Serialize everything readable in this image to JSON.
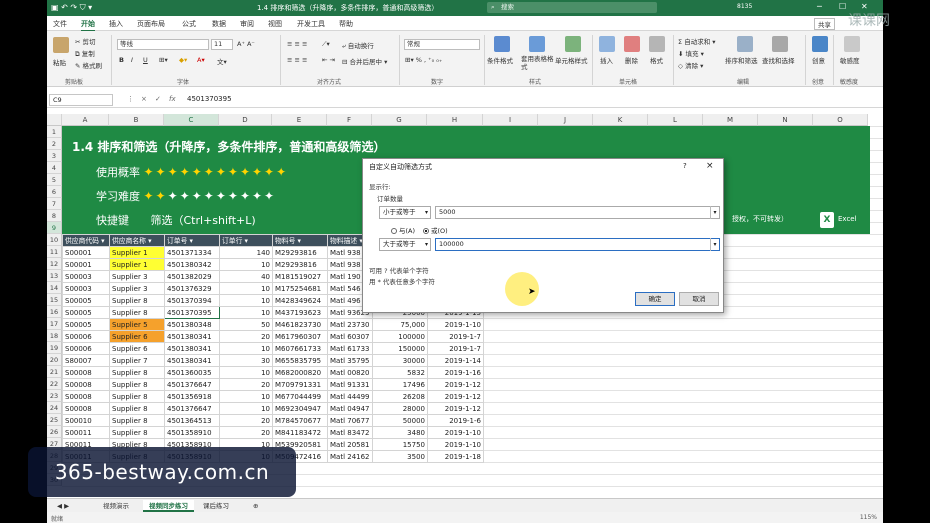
{
  "window": {
    "title": "1.4 排序和筛选（升降序，多条件排序，普通和高级筛选）",
    "search_placeholder": "搜索",
    "user": "8135",
    "logo": "课课网"
  },
  "ribbon": {
    "tabs": [
      "文件",
      "开始",
      "插入",
      "页面布局",
      "公式",
      "数据",
      "审阅",
      "视图",
      "开发工具",
      "帮助"
    ],
    "active_tab": "开始",
    "share_label": "共享",
    "groups": {
      "clipboard": {
        "label": "剪贴板",
        "paste": "粘贴",
        "cut": "剪切",
        "copy": "复制",
        "format_painter": "格式刷"
      },
      "font": {
        "label": "字体",
        "font_name": "等线",
        "font_size": "11",
        "bold": "B",
        "italic": "I",
        "underline": "U"
      },
      "alignment": {
        "label": "对齐方式",
        "wrap": "自动换行",
        "merge": "合并后居中"
      },
      "number": {
        "label": "数字",
        "format": "常规"
      },
      "styles": {
        "label": "样式",
        "conditional": "条件格式",
        "table": "套用表格格式",
        "cell_styles": "单元格样式"
      },
      "cells": {
        "label": "单元格",
        "insert": "插入",
        "delete": "删除",
        "format": "格式"
      },
      "editing": {
        "label": "编辑",
        "autosum": "自动求和",
        "fill": "填充",
        "clear": "清除",
        "sort_filter": "排序和筛选",
        "find_select": "查找和选择"
      },
      "creative": {
        "label": "创意",
        "btn": "创意"
      },
      "sensitivity": {
        "label": "敏感度",
        "btn": "敏感度"
      }
    }
  },
  "formula_bar": {
    "name_box": "C9",
    "cancel": "×",
    "enter": "✓",
    "fx": "fx",
    "value": "4501370395"
  },
  "columns": [
    "A",
    "B",
    "C",
    "D",
    "E",
    "F",
    "G",
    "H",
    "I",
    "J",
    "K",
    "L",
    "M",
    "N",
    "O"
  ],
  "selected_column": "C",
  "rows": [
    "1",
    "2",
    "3",
    "4",
    "5",
    "6",
    "7",
    "8",
    "9",
    "10",
    "11",
    "12",
    "13",
    "14",
    "15",
    "16",
    "17",
    "18",
    "19",
    "20",
    "21",
    "22",
    "23",
    "24",
    "25",
    "26",
    "27",
    "28",
    "29",
    "30"
  ],
  "selected_row": "9",
  "banner": {
    "title": "1.4 排序和筛选（升降序，多条件排序，普通和高级筛选）",
    "usage_label": "使用概率",
    "usage_stars": "✦✦✦✦✦✦✦✦✦✦✦✦",
    "difficulty_label": "学习难度",
    "difficulty_stars_yellow": "✦✦",
    "difficulty_stars_white": "✦✦✦✦✦✦✦✦✦",
    "shortcut_label": "快捷键",
    "shortcut_value": "筛选（Ctrl+shift+L)",
    "note": "授权，不可转发）",
    "excel_label": "Excel",
    "excel_letter": "X"
  },
  "table": {
    "headers": [
      "供应商代码",
      "供应商名称",
      "订单号",
      "订单行",
      "物料号",
      "物料描述",
      "",
      ""
    ],
    "rows": [
      [
        "S00001",
        "Supplier 1",
        "4501371334",
        "140",
        "M29293816",
        "Matl 938",
        "",
        ""
      ],
      [
        "S00001",
        "Supplier 1",
        "4501380342",
        "10",
        "M29293816",
        "Matl 938",
        "",
        ""
      ],
      [
        "S00003",
        "Supplier 3",
        "4501382029",
        "40",
        "M181519027",
        "Matl 190",
        "",
        ""
      ],
      [
        "S00003",
        "Supplier 3",
        "4501376329",
        "10",
        "M175254681",
        "Matl 546",
        "",
        ""
      ],
      [
        "S00005",
        "Supplier 8",
        "4501370394",
        "10",
        "M428349624",
        "Matl 496",
        "",
        ""
      ],
      [
        "S00005",
        "Supplier 8",
        "4501370395",
        "10",
        "M437193623",
        "Matl 93623",
        "25000",
        "2019-1-15"
      ],
      [
        "S00005",
        "Supplier 5",
        "4501380348",
        "50",
        "M461823730",
        "Matl 23730",
        "75,000",
        "2019-1-10"
      ],
      [
        "S00006",
        "Supplier 6",
        "4501380341",
        "20",
        "M617960307",
        "Matl 60307",
        "100000",
        "2019-1-7"
      ],
      [
        "S00006",
        "Supplier 6",
        "4501380341",
        "10",
        "M607661733",
        "Matl 61733",
        "150000",
        "2019-1-7"
      ],
      [
        "S80007",
        "Supplier 7",
        "4501380341",
        "30",
        "M655835795",
        "Matl 35795",
        "30000",
        "2019-1-14"
      ],
      [
        "S00008",
        "Supplier 8",
        "4501360035",
        "10",
        "M682000820",
        "Matl 00820",
        "5832",
        "2019-1-16"
      ],
      [
        "S00008",
        "Supplier 8",
        "4501376647",
        "20",
        "M709791331",
        "Matl 91331",
        "17496",
        "2019-1-12"
      ],
      [
        "S00008",
        "Supplier 8",
        "4501356918",
        "10",
        "M677044499",
        "Matl 44499",
        "26208",
        "2019-1-12"
      ],
      [
        "S00008",
        "Supplier 8",
        "4501376647",
        "10",
        "M692304947",
        "Matl 04947",
        "28000",
        "2019-1-12"
      ],
      [
        "S00010",
        "Supplier 8",
        "4501364513",
        "20",
        "M784570677",
        "Matl 70677",
        "50000",
        "2019-1-6"
      ],
      [
        "S00011",
        "Supplier 8",
        "4501358910",
        "20",
        "M841183472",
        "Matl 83472",
        "3480",
        "2019-1-10"
      ],
      [
        "S00011",
        "Supplier 8",
        "4501358910",
        "10",
        "M539920581",
        "Matl 20581",
        "15750",
        "2019-1-10"
      ],
      [
        "S00011",
        "Supplier 8",
        "4501358910",
        "10",
        "M509472416",
        "Matl 24162",
        "3500",
        "2019-1-18"
      ]
    ]
  },
  "dialog": {
    "title": "自定义自动筛选方式",
    "help": "?",
    "close": "×",
    "show_rows": "显示行:",
    "field": "订单数量",
    "op1": "小于或等于",
    "val1": "5000",
    "and_label": "与(A)",
    "or_label": "或(O)",
    "op2": "大于或等于",
    "val2": "100000",
    "hint1": "可用 ? 代表单个字符",
    "hint2": "用 * 代表任意多个字符",
    "ok": "确定",
    "cancel": "取消"
  },
  "sheet_tabs": [
    "视频演示",
    "视频同步练习",
    "课后练习"
  ],
  "active_sheet": "视频同步练习",
  "status": {
    "left": "就绪",
    "zoom": "115%"
  },
  "watermark": "365-bestway.com.cn"
}
